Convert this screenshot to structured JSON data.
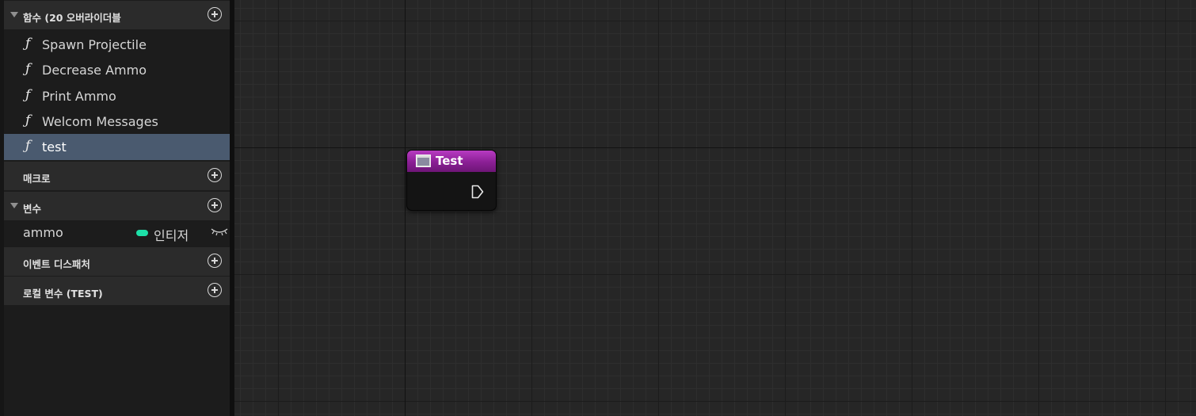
{
  "sidebar": {
    "functions_section": {
      "title": "함수 (20 오버라이더블"
    },
    "functions": [
      {
        "icon": "function-icon",
        "glyph": "ƒ",
        "label": "Spawn Projectile",
        "selected": false
      },
      {
        "icon": "function-icon",
        "glyph": "ƒ",
        "label": "Decrease Ammo",
        "selected": false
      },
      {
        "icon": "function-icon",
        "glyph": "ƒ",
        "label": "Print Ammo",
        "selected": false
      },
      {
        "icon": "function-icon",
        "glyph": "ƒ",
        "label": "Welcom Messages",
        "selected": false
      },
      {
        "icon": "function-icon",
        "glyph": "ƒ",
        "label": "test",
        "selected": true
      }
    ],
    "macros_section": {
      "title": "매크로"
    },
    "variables_section": {
      "title": "변수"
    },
    "variables": [
      {
        "name": "ammo",
        "type": "인티저",
        "type_color": "#1de0a8",
        "visibility_icon": "eye-closed-icon"
      }
    ],
    "event_dispatchers_section": {
      "title": "이벤트 디스패처"
    },
    "local_variables_section": {
      "title": "로컬 변수 (TEST)"
    }
  },
  "graph": {
    "node": {
      "title": "Test",
      "icon": "function-entry-icon",
      "header_color": "#8a1f94",
      "exec_pin": "exec-output-pin-icon"
    }
  },
  "colors": {
    "selected_row": "#4a5a6f",
    "panel_bg": "#1c1c1c",
    "section_header_bg": "#2b2b2b",
    "graph_bg": "#262626",
    "integer_type": "#1de0a8"
  }
}
